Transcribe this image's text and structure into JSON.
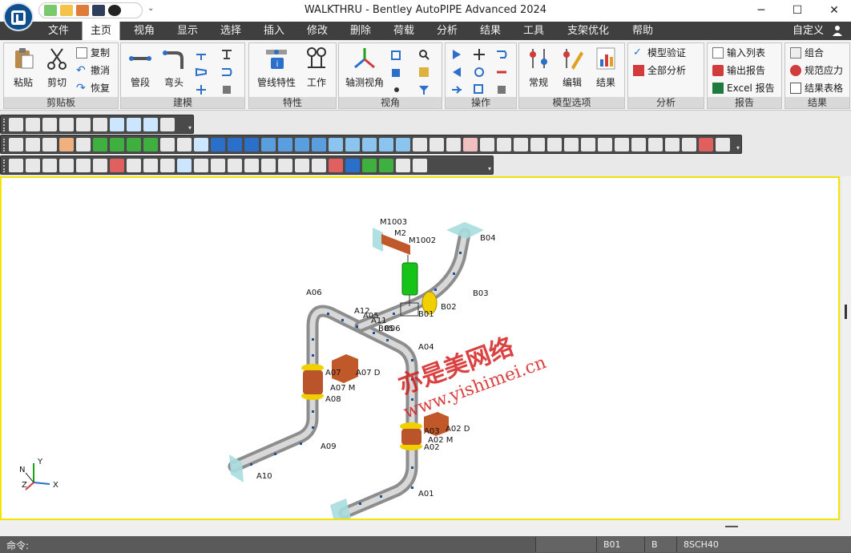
{
  "app": {
    "title": "WALKTHRU - Bentley AutoPIPE Advanced 2024",
    "window_buttons": {
      "minimize": "─",
      "maximize": "☐",
      "close": "✕"
    }
  },
  "tabs": [
    "文件",
    "主页",
    "视角",
    "显示",
    "选择",
    "插入",
    "修改",
    "删除",
    "荷载",
    "分析",
    "结果",
    "工具",
    "支架优化",
    "帮助"
  ],
  "active_tab": "主页",
  "customize": "自定义",
  "ribbon": {
    "clipboard": {
      "caption": "剪贴板",
      "paste": "粘贴",
      "cut": "剪切",
      "copy": "复制",
      "undo": "撤消",
      "redo": "恢复"
    },
    "modeling": {
      "caption": "建模",
      "segment": "管段",
      "bend": "弯头"
    },
    "properties": {
      "caption": "特性",
      "pipe_props": "管线特性",
      "work": "工作"
    },
    "view": {
      "caption": "视角",
      "iso_view": "轴测视角"
    },
    "operation": {
      "caption": "操作"
    },
    "model_options": {
      "caption": "模型选项",
      "general": "常规",
      "edit": "编辑",
      "results": "结果"
    },
    "analysis": {
      "caption": "分析",
      "model_check": "模型验证",
      "all_analysis": "全部分析"
    },
    "report": {
      "caption": "报告",
      "input_list": "输入列表",
      "output_report": "输出报告",
      "excel_report": "Excel 报告"
    },
    "results": {
      "caption": "结果",
      "combination": "组合",
      "code_stress": "规范应力",
      "result_table": "结果表格"
    }
  },
  "colors": {
    "accent_yellow": "#f2e300",
    "pipe": "#b4b4b4",
    "support": "#a8dde0",
    "hanger": "#16c419",
    "flange": "#f0d000",
    "valve": "#c0582a"
  },
  "viewport": {
    "labels": {
      "m1003": "M1003",
      "m2": "M2",
      "m1002": "M1002",
      "b04": "B04",
      "b03": "B03",
      "b02": "B02",
      "b01": "B01",
      "a06": "A06",
      "a12": "A12",
      "a05": "A05",
      "a11": "A11",
      "b05": "B05",
      "b06": "B06",
      "a04": "A04",
      "a07": "A07",
      "a07d": "A07 D",
      "a07m": "A07 M",
      "a08": "A08",
      "a03": "A03",
      "a02d": "A02 D",
      "a02m": "A02 M",
      "a02": "A02",
      "a09": "A09",
      "a10": "A10",
      "a01": "A01"
    },
    "watermark_cn": "亦是美网络",
    "watermark_url": "www.yishimei.cn",
    "axes": {
      "x": "X",
      "y": "Y",
      "z": "Z",
      "n": "N"
    }
  },
  "status": {
    "command_label": "命令:",
    "point": "B01",
    "segment": "B",
    "pipe_id": "8SCH40"
  }
}
